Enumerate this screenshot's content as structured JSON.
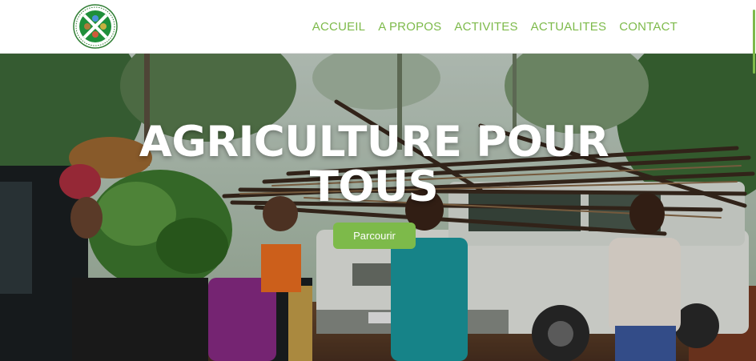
{
  "header": {
    "logo_icon": "organization-logo",
    "nav": [
      {
        "label": "ACCUEIL"
      },
      {
        "label": "A PROPOS"
      },
      {
        "label": "ACTIVITES"
      },
      {
        "label": "ACTUALITES"
      },
      {
        "label": "CONTACT"
      }
    ]
  },
  "hero": {
    "title_line1": "AGRICULTURE POUR",
    "title_line2": "TOUS",
    "cta_label": "Parcourir",
    "background_image": "farmers-carrying-cassava-stems-beside-trucks"
  },
  "colors": {
    "accent": "#7dba4a",
    "nav_text": "#7dba4a",
    "hero_text": "#ffffff"
  }
}
